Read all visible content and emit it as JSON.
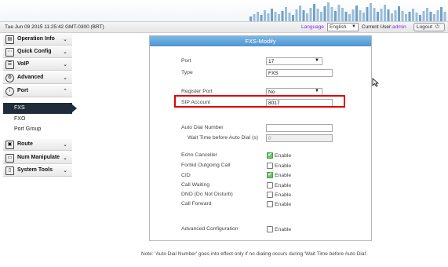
{
  "header": {
    "datetime": "Tue Jun 09 2015 11:25:42 GMT-0300 (BRT)",
    "language_label": "Language",
    "language_value": "English",
    "current_user_label": "Current User:",
    "current_user": "admin",
    "logout_label": "Logout"
  },
  "sidebar": {
    "items": [
      {
        "label": "Operation Info",
        "icon": "info-icon"
      },
      {
        "label": "Quick Config",
        "icon": "config-icon"
      },
      {
        "label": "VoIP",
        "icon": "voip-icon"
      },
      {
        "label": "Advanced",
        "icon": "gear-icon"
      },
      {
        "label": "Port",
        "icon": "port-icon"
      }
    ],
    "port_sub": [
      "FXS",
      "FXO",
      "Port Group"
    ],
    "items2": [
      {
        "label": "Route",
        "icon": "route-icon"
      },
      {
        "label": "Num Manipulate",
        "icon": "num-manipulate-icon"
      },
      {
        "label": "System Tools",
        "icon": "tools-icon"
      }
    ]
  },
  "panel": {
    "title": "FXS-Modify",
    "port_label": "Port",
    "port_value": "17",
    "type_label": "Type",
    "type_value": "FXS",
    "register_port_label": "Register Port",
    "register_port_value": "No",
    "sip_account_label": "SIP Account",
    "sip_account_value": "8017",
    "auto_dial_label": "Auto Dial Number",
    "auto_dial_value": "",
    "wait_time_label": "Wait Time before Auto Dial (s)",
    "wait_time_value": "0",
    "options": [
      {
        "label": "Echo Canceller",
        "checked": true
      },
      {
        "label": "Forbid Outgoing Call",
        "checked": false
      },
      {
        "label": "CID",
        "checked": true
      },
      {
        "label": "Call Waiting",
        "checked": false
      },
      {
        "label": "DND (Do Not Disturb)",
        "checked": false
      },
      {
        "label": "Call Forward",
        "checked": false
      }
    ],
    "enable_label": "Enable",
    "advanced_config_label": "Advanced Configuration",
    "advanced_config_checked": false
  },
  "note": "Note: 'Auto Dial Number' goes into effect only if no dialing occurs during 'Wait Time before Auto Dial'.",
  "colors": {
    "title_bar": "#5aa0d8",
    "highlight": "#e00000",
    "active_nav": "#1f2d3a",
    "user_accent": "#8a2be2",
    "check_green": "#6fc36f"
  }
}
